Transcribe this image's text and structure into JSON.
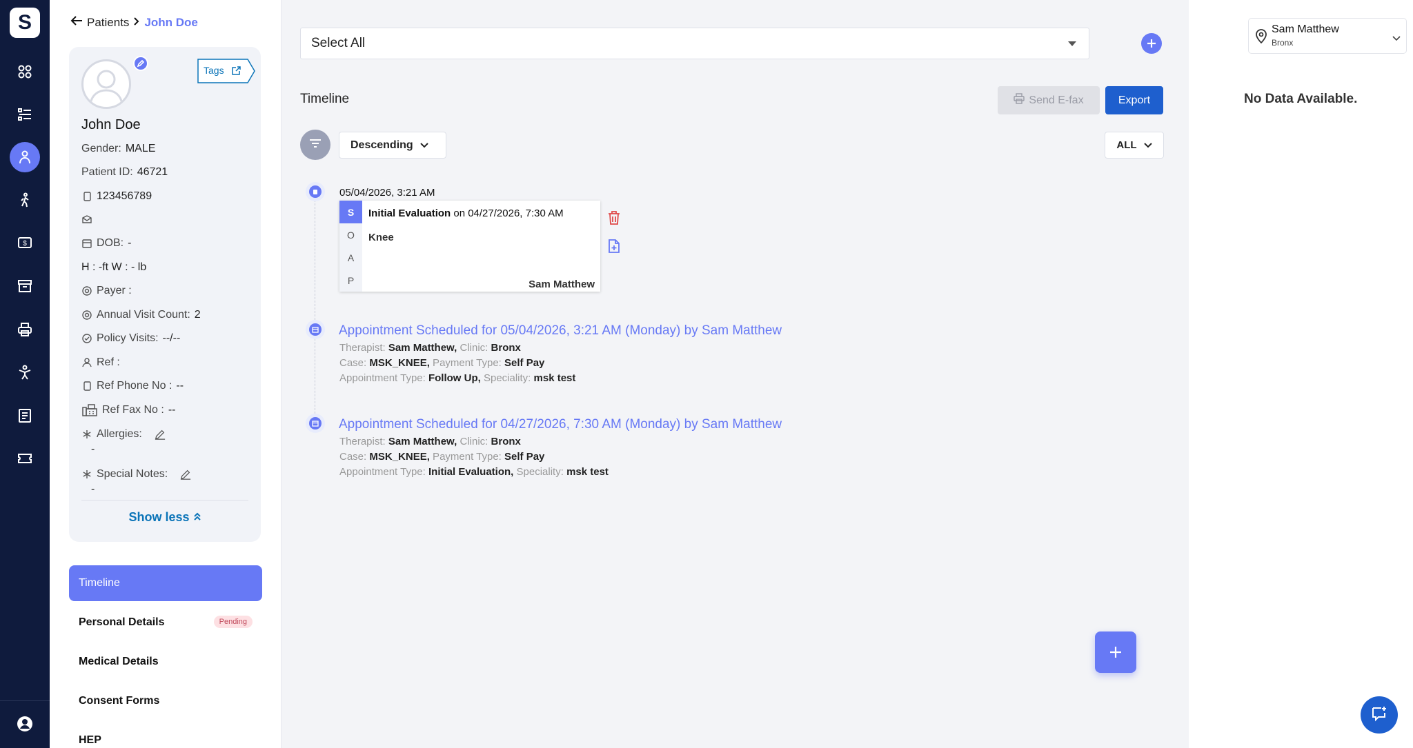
{
  "app": {
    "logo": "S"
  },
  "rail": {
    "icons": [
      "dashboard-icon",
      "list-icon",
      "patient-icon",
      "walking-icon",
      "billing-icon",
      "archive-icon",
      "print-icon",
      "exercise-icon",
      "document-icon",
      "ticket-icon",
      "user-account-icon"
    ]
  },
  "breadcrumb": {
    "parent": "Patients",
    "current": "John Doe"
  },
  "patient": {
    "tags_label": "Tags",
    "name": "John Doe",
    "gender_label": "Gender:",
    "gender": "MALE",
    "id_label": "Patient ID:",
    "id": "46721",
    "phone": "123456789",
    "dob_label": "DOB:",
    "dob": "-",
    "height_weight": "H : -ft W : - lb",
    "payer_label": "Payer :",
    "visit_count_label": "Annual Visit Count:",
    "visit_count": "2",
    "policy_visits_label": "Policy Visits:",
    "policy_visits": "--/--",
    "ref_label": "Ref :",
    "ref_phone_label": "Ref Phone No :",
    "ref_phone": "--",
    "ref_fax_label": "Ref Fax No :",
    "ref_fax": "--",
    "allergies_label": "Allergies:",
    "allergies": "-",
    "special_notes_label": "Special Notes:",
    "special_notes": "-",
    "show_less": "Show less"
  },
  "patient_nav": [
    {
      "label": "Timeline",
      "active": true
    },
    {
      "label": "Personal Details",
      "badge": "Pending"
    },
    {
      "label": "Medical Details"
    },
    {
      "label": "Consent Forms"
    },
    {
      "label": "HEP"
    }
  ],
  "main": {
    "select_all": "Select All",
    "timeline_title": "Timeline",
    "send_efax": "Send E-fax",
    "export": "Export",
    "sort": "Descending",
    "filter": "ALL",
    "note": {
      "timestamp": "05/04/2026, 3:21 AM",
      "soap_letters": [
        "S",
        "O",
        "A",
        "P"
      ],
      "title": "Initial Evaluation",
      "title_suffix": " on 04/27/2026, 7:30 AM",
      "description": "Knee",
      "author": "Sam Matthew"
    },
    "appointments": [
      {
        "title": "Appointment Scheduled for 05/04/2026, 3:21 AM (Monday) by Sam Matthew",
        "therapist_label": "Therapist:",
        "therapist": "Sam Matthew,",
        "clinic_label": " Clinic:",
        "clinic": "Bronx",
        "case_label": "Case:",
        "case": "MSK_KNEE,",
        "payment_label": " Payment Type:",
        "payment": "Self Pay",
        "type_label": "Appointment Type:",
        "type": "Follow Up,",
        "speciality_label": " Speciality:",
        "speciality": "msk test"
      },
      {
        "title": "Appointment Scheduled for 04/27/2026, 7:30 AM (Monday) by Sam Matthew",
        "therapist_label": "Therapist:",
        "therapist": "Sam Matthew,",
        "clinic_label": " Clinic:",
        "clinic": "Bronx",
        "case_label": "Case:",
        "case": "MSK_KNEE,",
        "payment_label": " Payment Type:",
        "payment": "Self Pay",
        "type_label": "Appointment Type:",
        "type": "Initial Evaluation,",
        "speciality_label": " Speciality:",
        "speciality": "msk test"
      }
    ]
  },
  "right_panel": {
    "location_name": "Sam Matthew",
    "location_sub": "Bronx",
    "no_data": "No Data Available."
  },
  "colors": {
    "rail_bg": "#0f1b3d",
    "accent": "#6779f5",
    "primary_button": "#1e5fce",
    "danger": "#e04848"
  }
}
